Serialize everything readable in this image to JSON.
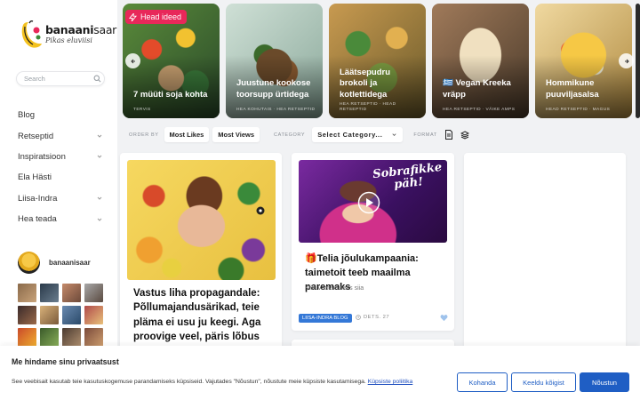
{
  "logo": {
    "main_bold": "banaani",
    "main_thin": "saar",
    "sub": "Pikas eluviisi"
  },
  "search": {
    "placeholder": "Search"
  },
  "nav": [
    {
      "label": "Blog",
      "has_chevron": false
    },
    {
      "label": "Retseptid",
      "has_chevron": true
    },
    {
      "label": "Inspiratsioon",
      "has_chevron": true
    },
    {
      "label": "Ela Hästi",
      "has_chevron": false
    },
    {
      "label": "Liisa-Indra",
      "has_chevron": true
    },
    {
      "label": "Hea teada",
      "has_chevron": true
    }
  ],
  "profile": {
    "name": "banaanisaar"
  },
  "slider": {
    "badge": "Head ideed",
    "slides": [
      {
        "title": "7 müüti soja kohta",
        "meta": "TERVIS"
      },
      {
        "title": "Juustune kookose toorsupp ürtidega",
        "meta": "HEA KOHUTAIS · HEA RETSEPTID"
      },
      {
        "title": "Läätsepudru brokoli ja kotlettidega",
        "meta": "HEA RETSEPTID · HEAD RETSEPTID"
      },
      {
        "title": "🇬🇷 Vegan Kreeka vräpp",
        "meta": "HEA RETSEPTID · VÄIKE AMPS"
      },
      {
        "title": "Hommikune puuviljasalsa",
        "meta": "HEAD RETSEPTID · MAGUS"
      }
    ]
  },
  "filters": {
    "order_by": "ORDER BY",
    "most_likes": "Most Likes",
    "most_views": "Most Views",
    "category": "CATEGORY",
    "select_category": "Select Category...",
    "format": "FORMAT"
  },
  "posts": [
    {
      "title": "Vastus liha propagandale: Põllumajandusärikad, teie pläma ei usu ju keegi. Aga proovige veel, päris lõbus on!"
    },
    {
      "title": "🎁Telia jõulukampaania: taimetoit teeb maailma paremaks",
      "subtitle": "Kliki vaatamiseks siia",
      "category": "LIISA-INDRA BLOG",
      "date": "DETS. 27",
      "video_overlay": "Sobrafikke päh!"
    }
  ],
  "cookie": {
    "title": "Me hindame sinu privaatsust",
    "text": "See veebisait kasutab teie kasutuskogemuse parandamiseks küpsiseid. Vajutades \"Nõustun\", nõustute meie küpsiste kasutamisega.",
    "link": "Küpsiste poliitika",
    "customize": "Kohanda",
    "reject": "Keeldu kõigist",
    "accept": "Nõustun"
  },
  "colors": {
    "accent_pink": "#e8285a",
    "accent_blue": "#1f5ec4",
    "badge_blue": "#3478d7"
  }
}
